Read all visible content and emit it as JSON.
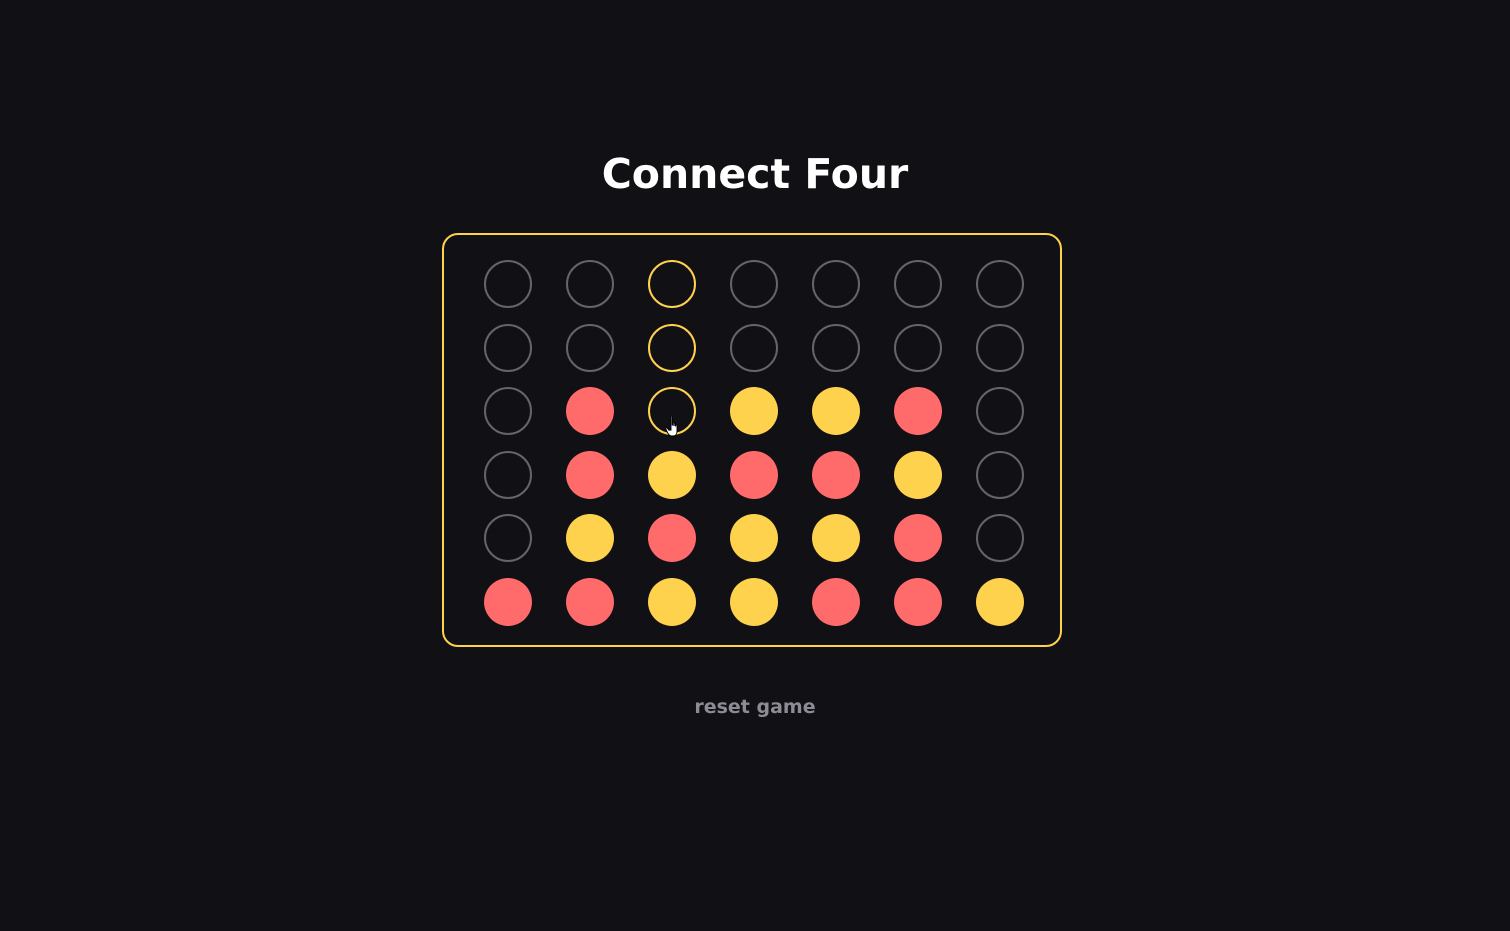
{
  "title": "Connect Four",
  "reset_label": "reset game",
  "colors": {
    "background": "#111015",
    "accent": "#ffd24d",
    "red_piece": "#ff6b6b",
    "yellow_piece": "#ffd24d",
    "empty_border": "#66646b",
    "reset_text": "#8d8b94"
  },
  "board": {
    "columns": 7,
    "rows": 6,
    "hover_column": 2,
    "cells": [
      [
        "empty",
        "empty",
        "empty",
        "empty",
        "empty",
        "empty",
        "empty"
      ],
      [
        "empty",
        "empty",
        "empty",
        "empty",
        "empty",
        "empty",
        "empty"
      ],
      [
        "empty",
        "red",
        "empty",
        "yellow",
        "yellow",
        "red",
        "empty"
      ],
      [
        "empty",
        "red",
        "yellow",
        "red",
        "red",
        "yellow",
        "empty"
      ],
      [
        "empty",
        "yellow",
        "red",
        "yellow",
        "yellow",
        "red",
        "empty"
      ],
      [
        "red",
        "red",
        "yellow",
        "yellow",
        "red",
        "red",
        "yellow"
      ]
    ]
  },
  "cursor_icon": "hand-pointer-icon"
}
